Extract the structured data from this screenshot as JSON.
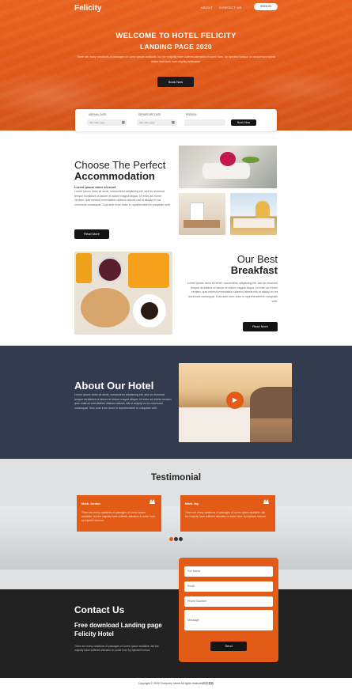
{
  "header": {
    "logo": "Felicity",
    "nav": [
      "ABOUT",
      "CONTACT US"
    ],
    "signin": "SIGN IN"
  },
  "hero": {
    "title_line1": "WELCOME TO HOTEL FELICITY",
    "title_line2": "LANDING PAGE 2020",
    "subtitle": "There are many variations of passages of Lorem Ipsum available, but the majority have suffered alteration in some form, by injected humour, or randomised words which don't look even slightly believable.",
    "button": "Book Now"
  },
  "booking": {
    "arrival_label": "ARRIVAL DATE",
    "arrival_value": "mm / dd / yyyy",
    "departure_label": "DEPARTURE DATE",
    "departure_value": "mm / dd / yyyy",
    "person_label": "PERSON",
    "button": "Book Now"
  },
  "accommodation": {
    "title_light": "Choose The Perfect",
    "title_bold": "Accommodation",
    "lead": "Lorem ipsum dolor sit amet",
    "text": "Lorem ipsum dolor sit amet, consectetur adipiscing elit, sed do eiusmod tempor incididunt ut labore et dolore magna aliqua. Ut enim ad minim veniam, quis nostrud exercitation ullamco laboris nisi ut aliquip ex ea commodo consequat. Duis aute irure dolor in reprehenderit in voluptate velit.",
    "button": "Read More"
  },
  "breakfast": {
    "title_light": "Our Best",
    "title_bold": "Breakfast",
    "text": "Lorem ipsum dolor sit amet, consectetur adipiscing elit, sed do eiusmod tempor incididunt ut labore et dolore magna aliqua. Ut enim ad minim veniam, quis nostrud exercitation ullamco laboris nisi ut aliquip ex ea commodo consequat. Duis aute irure dolor in reprehenderit in voluptate velit.",
    "button": "Read More"
  },
  "about": {
    "title": "About Our Hotel",
    "text": "Lorem ipsum dolor sit amet, consectetur adipiscing elit, sed do eiusmod tempor incididunt ut labore et dolore magna aliqua. Ut enim ad minim veniam, quis nostrud exercitation ullamco laboris nisi ut aliquip ex ea commodo consequat. Duis aute irure dolor in reprehenderit in voluptate velit."
  },
  "testimonial": {
    "title": "Testimonial",
    "cards": [
      {
        "name": "Mark Jordan",
        "text": "There are many variations of passages of Lorem Ipsum available, but the majority have suffered alteration in some form, by injected humour."
      },
      {
        "name": "Mark Jay",
        "text": "There are many variations of passages of Lorem Ipsum available, but the majority have suffered alteration in some form, by injected humour."
      }
    ],
    "quote_mark": "❝"
  },
  "contact": {
    "title": "Contact Us",
    "subtitle": "Free download Landing page Felicity Hotel",
    "text": "There are many variations of passages of Lorem Ipsum available, but the majority have suffered alteration in some form by injected humour.",
    "form": {
      "full_name": "Full Name",
      "email": "Email",
      "phone": "Phone Number",
      "message": "Message",
      "button": "Send"
    }
  },
  "footer": {
    "copyright": "Copyright © 2020 Company name All rights reserved网页模板"
  },
  "colors": {
    "accent": "#e25b17",
    "dark_section": "#333b4f",
    "contact_bg": "#222222"
  }
}
